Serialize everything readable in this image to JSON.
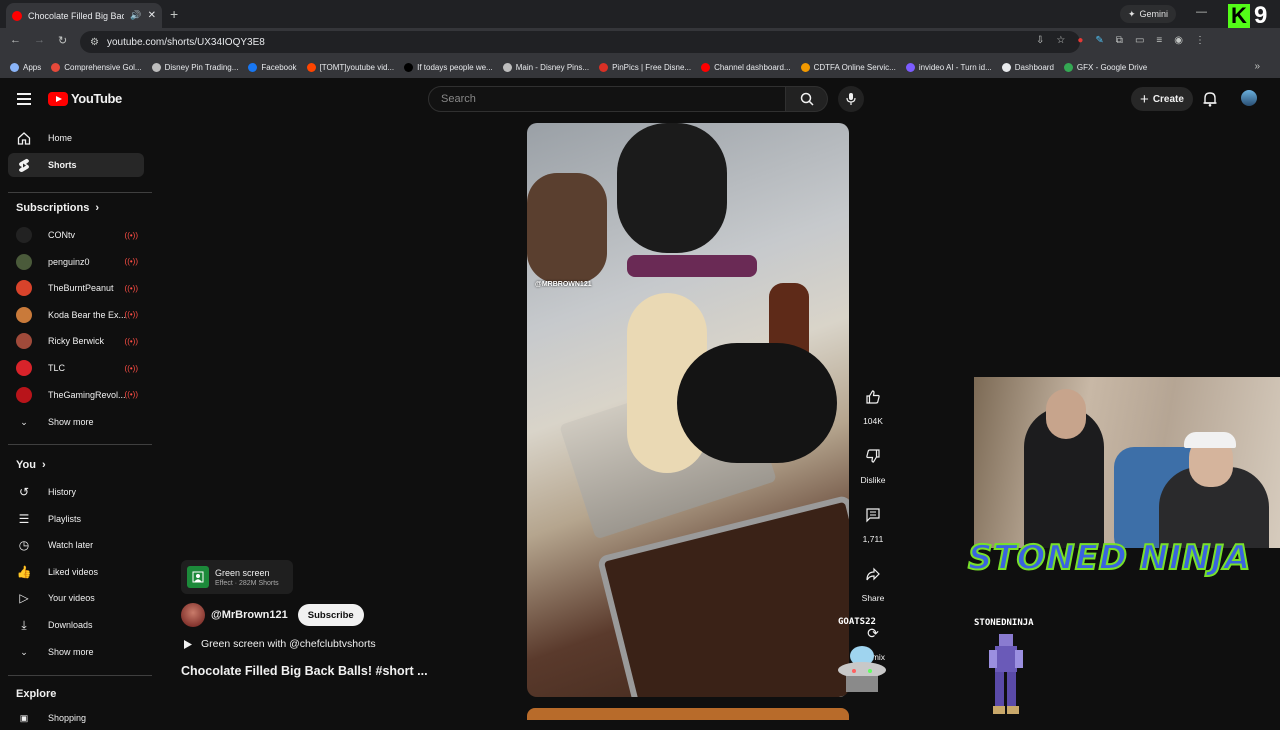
{
  "browser": {
    "tab_title": "Chocolate Filled Big Back B",
    "url": "youtube.com/shorts/UX34IOQY3E8",
    "gemini_label": "Gemini",
    "bookmarks": [
      {
        "label": "Apps",
        "color": "#8ab4f8"
      },
      {
        "label": "Comprehensive Gol...",
        "color": "#e5493a"
      },
      {
        "label": "Disney Pin Trading...",
        "color": "#bdbdbd"
      },
      {
        "label": "Facebook",
        "color": "#1877f2"
      },
      {
        "label": "[TOMT]youtube vid...",
        "color": "#ff4500"
      },
      {
        "label": "If todays people we...",
        "color": "#000000"
      },
      {
        "label": "Main - Disney Pins...",
        "color": "#bdbdbd"
      },
      {
        "label": "PinPics | Free Disne...",
        "color": "#d93025"
      },
      {
        "label": "Channel dashboard...",
        "color": "#ff0000"
      },
      {
        "label": "CDTFA Online Servic...",
        "color": "#f29900"
      },
      {
        "label": "invideo AI - Turn id...",
        "color": "#7c5cff"
      },
      {
        "label": "Dashboard",
        "color": "#e8eaed"
      },
      {
        "label": "GFX - Google Drive",
        "color": "#34a853"
      }
    ]
  },
  "overlay": {
    "k9_letter": "K",
    "k9_number": "9",
    "stoned_ninja": "STONED NINJA",
    "stoned_tag": "STONEDNINJA",
    "goats_tag": "GOATS22"
  },
  "youtube": {
    "logo_text": "YouTube",
    "search_placeholder": "Search",
    "create_label": "Create",
    "nav": [
      {
        "label": "Home",
        "icon": "home-icon"
      },
      {
        "label": "Shorts",
        "icon": "shorts-icon"
      }
    ],
    "subscriptions_heading": "Subscriptions",
    "subscriptions": [
      {
        "label": "CONtv",
        "color": "#222222"
      },
      {
        "label": "penguinz0",
        "color": "#4a5a3a"
      },
      {
        "label": "TheBurntPeanut",
        "color": "#d8432b"
      },
      {
        "label": "Koda Bear the Ex...",
        "color": "#c97a3a"
      },
      {
        "label": "Ricky Berwick",
        "color": "#a04a3a"
      },
      {
        "label": "TLC",
        "color": "#d8232a"
      },
      {
        "label": "TheGamingRevol...",
        "color": "#b8141a"
      }
    ],
    "show_more": "Show more",
    "you_heading": "You",
    "you_items": [
      {
        "label": "History",
        "icon": "history-icon"
      },
      {
        "label": "Playlists",
        "icon": "playlists-icon"
      },
      {
        "label": "Watch later",
        "icon": "clock-icon"
      },
      {
        "label": "Liked videos",
        "icon": "thumbs-up-icon"
      },
      {
        "label": "Your videos",
        "icon": "your-videos-icon"
      },
      {
        "label": "Downloads",
        "icon": "download-icon"
      }
    ],
    "show_more_2": "Show more",
    "explore_heading": "Explore",
    "explore_first": "Shopping"
  },
  "short": {
    "watermark": "@MRBROWN121",
    "effect_name": "Green screen",
    "effect_meta": "Effect · 282M Shorts",
    "channel": "@MrBrown121",
    "subscribe_label": "Subscribe",
    "green_screen_line": "Green screen with @chefclubtvshorts",
    "title": "Chocolate Filled Big Back Balls! #short ...",
    "like_count": "104K",
    "dislike_label": "Dislike",
    "comment_count": "1,711",
    "share_label": "Share",
    "remix_label": "Remix"
  }
}
